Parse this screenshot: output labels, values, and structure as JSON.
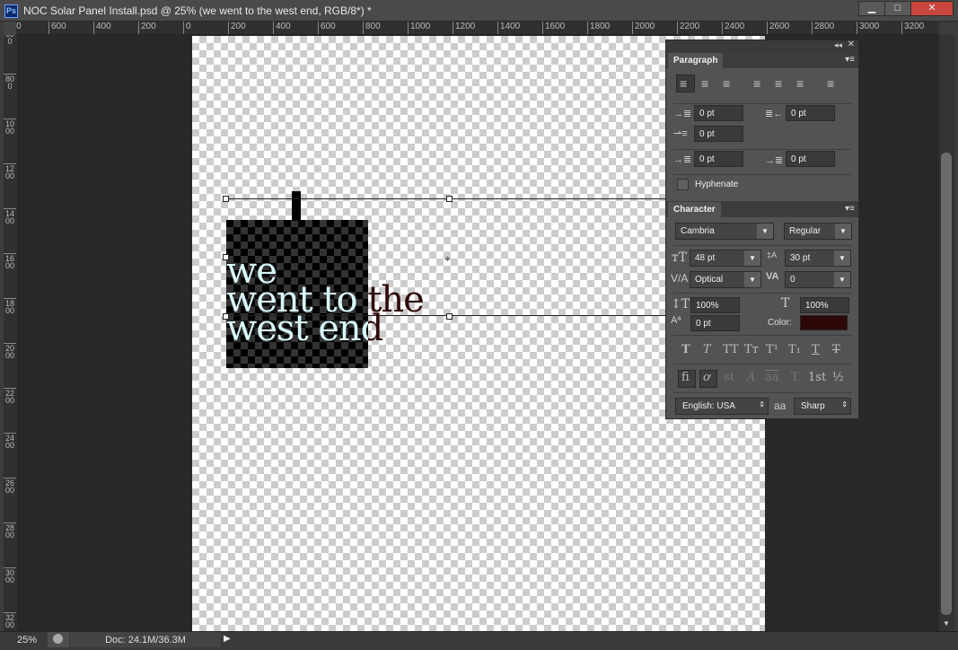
{
  "window": {
    "title": "NOC Solar Panel Install.psd @ 25% (we  went to the  west end, RGB/8*) *",
    "app_icon": "Ps",
    "minimize": "▁",
    "maximize": "□",
    "close": "✕"
  },
  "rulers": {
    "horizontal": [
      "800",
      "600",
      "400",
      "200",
      "0",
      "200",
      "400",
      "600",
      "800",
      "1000",
      "1200",
      "1400",
      "1600",
      "1800",
      "2000",
      "2200",
      "2400",
      "2600",
      "2800",
      "3000",
      "3200"
    ],
    "vertical": [
      "600",
      "800",
      "1000",
      "1200",
      "1400",
      "1600",
      "1800",
      "2000",
      "2200",
      "2400",
      "2600",
      "2800",
      "3000",
      "3200"
    ]
  },
  "canvas": {
    "text_lines": [
      "we",
      "went to the",
      "west end"
    ],
    "text_color": "#2e0808",
    "selected_text_color": "#d8f8fc"
  },
  "paragraph": {
    "tab": "Paragraph",
    "indent_left": "0 pt",
    "indent_right": "0 pt",
    "indent_first": "0 pt",
    "space_before": "0 pt",
    "space_after": "0 pt",
    "hyphenate_label": "Hyphenate",
    "hyphenate": false
  },
  "character": {
    "tab": "Character",
    "font_family": "Cambria",
    "font_style": "Regular",
    "font_size": "48 pt",
    "leading": "30 pt",
    "kerning": "Optical",
    "tracking": "0",
    "vertical_scale": "100%",
    "horizontal_scale": "100%",
    "baseline_shift": "0 pt",
    "color_label": "Color:",
    "color": "#2e0808",
    "language": "English: USA",
    "aa_icon": "aa",
    "antialias": "Sharp",
    "style_buttons": [
      "T",
      "T",
      "TT",
      "Tт",
      "T¹",
      "T₁",
      "T",
      "T"
    ],
    "opentype_buttons": [
      "ﬁ",
      "ơ",
      "st",
      "A",
      "aa",
      "T",
      "1st",
      "½"
    ]
  },
  "status": {
    "zoom": "25%",
    "doc": "Doc: 24.1M/36.3M"
  }
}
